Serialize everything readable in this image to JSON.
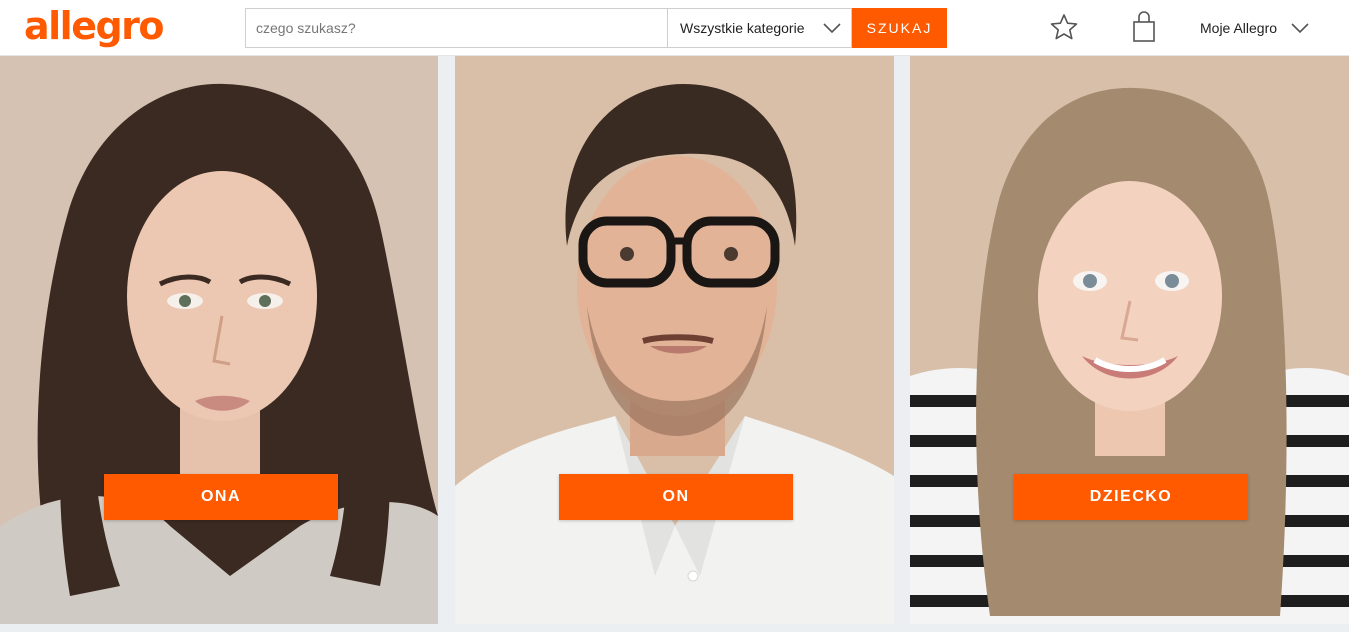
{
  "header": {
    "logo_text": "allegro",
    "search": {
      "placeholder": "czego szukasz?",
      "value": "",
      "category_label": "Wszystkie kategorie",
      "button_label": "SZUKAJ"
    },
    "account_label": "Moje Allegro",
    "icons": {
      "favorites": "star-icon",
      "cart": "shopping-bag-icon",
      "dropdown": "chevron-down-icon"
    }
  },
  "tiles": [
    {
      "label": "ONA",
      "image": "woman-portrait"
    },
    {
      "label": "ON",
      "image": "man-portrait"
    },
    {
      "label": "DZIECKO",
      "image": "child-portrait"
    }
  ],
  "colors": {
    "accent": "#ff5a00",
    "page_background": "#eceff1",
    "photo_background": "#d9bfa8"
  }
}
